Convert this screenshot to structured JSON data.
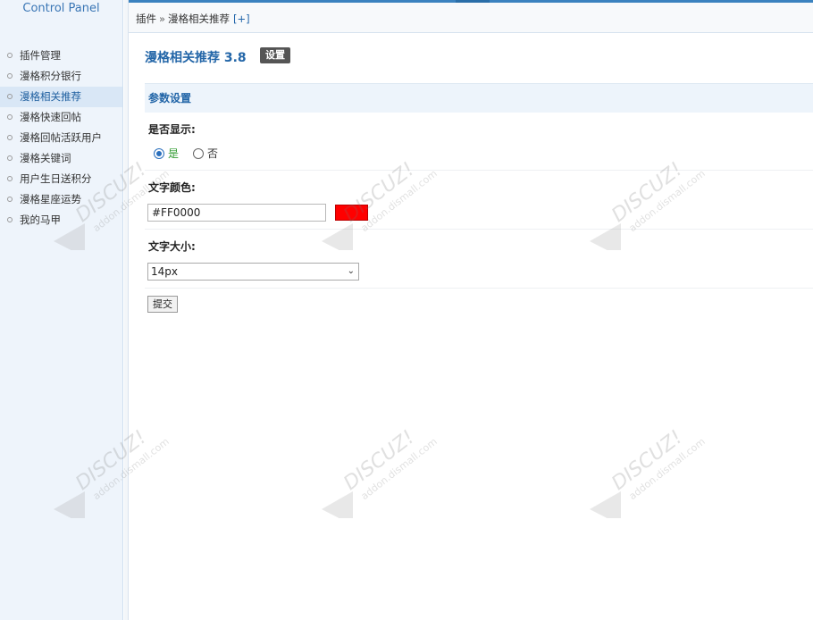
{
  "sidebar": {
    "title": "Control Panel",
    "items": [
      {
        "label": "插件管理"
      },
      {
        "label": "漫格积分银行"
      },
      {
        "label": "漫格相关推荐"
      },
      {
        "label": "漫格快速回帖"
      },
      {
        "label": "漫格回帖活跃用户"
      },
      {
        "label": "漫格关键词"
      },
      {
        "label": "用户生日送积分"
      },
      {
        "label": "漫格星座运势"
      },
      {
        "label": "我的马甲"
      }
    ]
  },
  "breadcrumb": {
    "root": "插件",
    "separator": "»",
    "current": "漫格相关推荐",
    "add": "[+]"
  },
  "main": {
    "plugin_title": "漫格相关推荐 3.8",
    "settings_button": "设置",
    "section_title": "参数设置",
    "show_label": "是否显示:",
    "radio_yes": "是",
    "radio_no": "否",
    "color_label": "文字颜色:",
    "color_value": "#FF0000",
    "size_label": "文字大小:",
    "size_value": "14px",
    "submit_button": "提交"
  },
  "colors": {
    "accent": "#3b82bf",
    "swatch": "#FF0000"
  }
}
